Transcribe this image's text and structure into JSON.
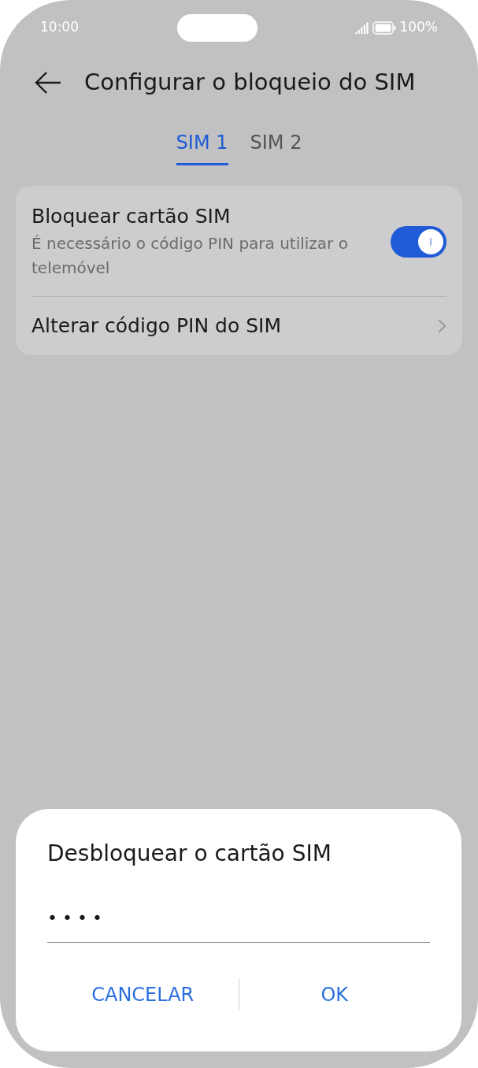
{
  "status_bar": {
    "time": "10:00",
    "battery": "100%"
  },
  "header": {
    "title": "Configurar o bloqueio do SIM"
  },
  "tabs": [
    {
      "label": "SIM 1",
      "selected": true
    },
    {
      "label": "SIM 2",
      "selected": false
    }
  ],
  "settings": [
    {
      "kind": "toggle",
      "title": "Bloquear cartão SIM",
      "subtitle": "É necessário o código PIN para utilizar o telemóvel",
      "on": true
    },
    {
      "kind": "link",
      "title": "Alterar código PIN do SIM"
    }
  ],
  "dialog": {
    "title": "Desbloquear o cartão SIM",
    "field": {
      "value": "••••"
    },
    "buttons": [
      "CANCELAR",
      "OK"
    ]
  }
}
